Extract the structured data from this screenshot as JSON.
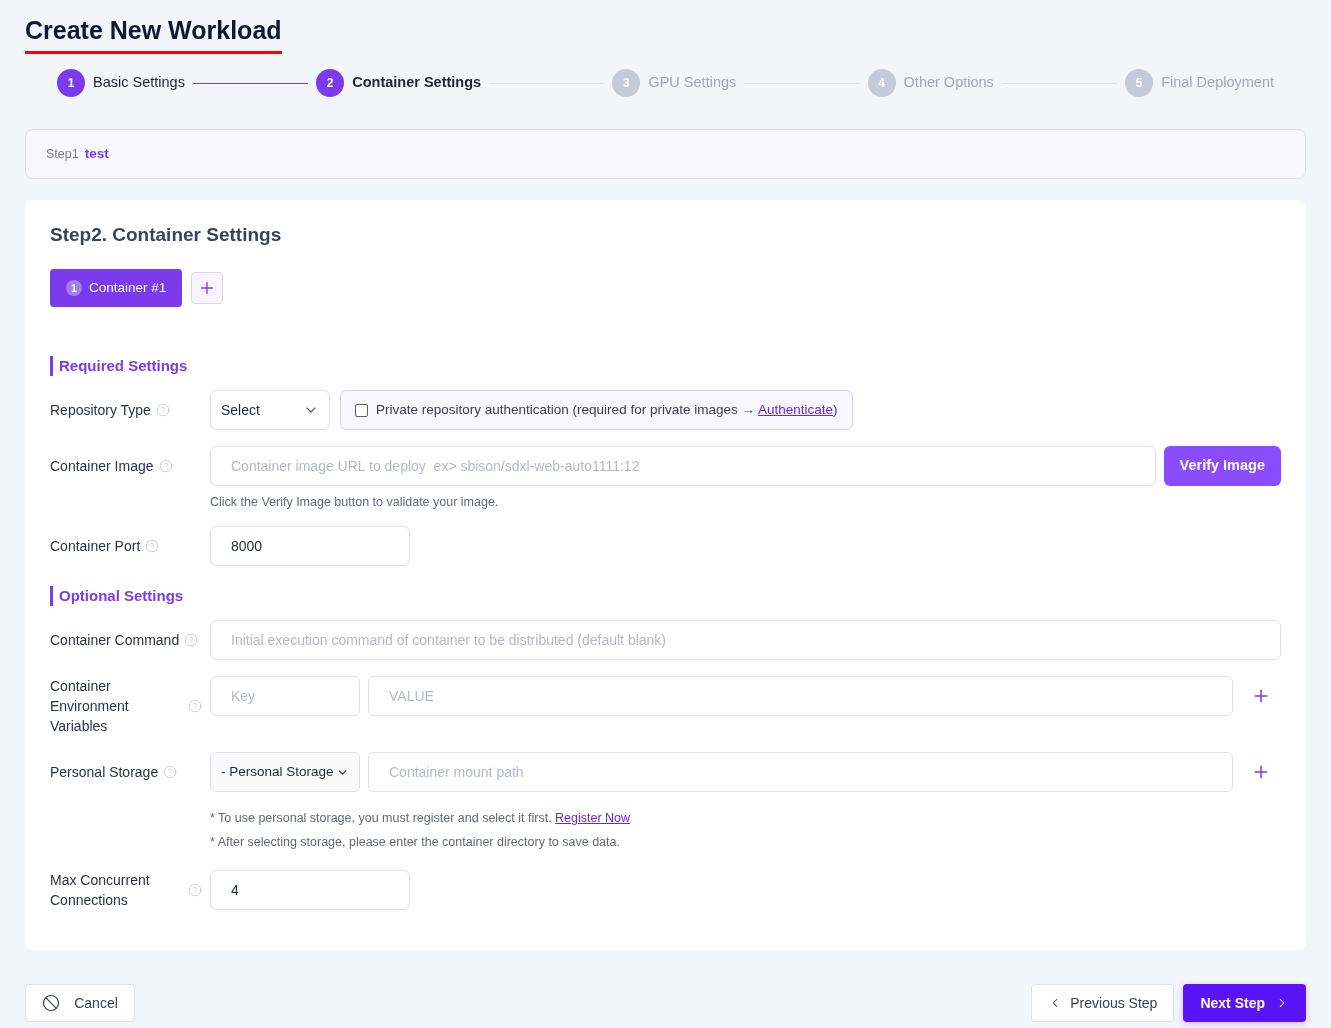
{
  "page": {
    "title": "Create New Workload"
  },
  "stepper": [
    {
      "number": "1",
      "label": "Basic Settings",
      "active": true,
      "selected": false
    },
    {
      "number": "2",
      "label": "Container Settings",
      "active": true,
      "selected": true
    },
    {
      "number": "3",
      "label": "GPU Settings",
      "active": false,
      "selected": false
    },
    {
      "number": "4",
      "label": "Other Options",
      "active": false,
      "selected": false
    },
    {
      "number": "5",
      "label": "Final Deployment",
      "active": false,
      "selected": false
    }
  ],
  "summary": {
    "label": "Step1",
    "value": "test"
  },
  "section": {
    "title": "Step2. Container Settings"
  },
  "container_tabs": [
    {
      "number": "1",
      "label": "Container #1",
      "selected": true
    }
  ],
  "groups": [
    {
      "title": "Required Settings",
      "fields": [
        {
          "kind": "select",
          "label": "Repository Type",
          "select": "Select",
          "auth": {
            "checked": false,
            "text": "Private repository authentication (required for private images → ",
            "link": "Authenticate",
            "suffix": ")"
          }
        },
        {
          "kind": "verify",
          "label": "Container Image",
          "placeholder": "Container image URL to deploy  ex> sbison/sdxl-web-auto1111:12",
          "button": "Verify Image",
          "hint": "Click the Verify Image button to validate your image."
        },
        {
          "kind": "short",
          "label": "Container Port",
          "value": "8000"
        }
      ]
    },
    {
      "title": "Optional Settings",
      "fields": [
        {
          "kind": "wide",
          "label": "Container Command",
          "placeholder": "Initial execution command of container to be distributed (default blank)"
        },
        {
          "kind": "pair",
          "label": "Container Environment Variables",
          "key_placeholder": "Key",
          "value_placeholder": "VALUE"
        },
        {
          "kind": "storage",
          "label": "Personal Storage",
          "select": "- Personal Storage",
          "placeholder": "Container mount path",
          "notes": [
            {
              "text": "* To use personal storage, you must register and select it first. ",
              "link": "Register Now"
            },
            {
              "text": "* After selecting storage, please enter the container directory to save data."
            }
          ]
        },
        {
          "kind": "short",
          "label": "Max Concurrent Connections",
          "value": "4"
        }
      ]
    }
  ],
  "footer": {
    "cancel": "Cancel",
    "previous": "Previous Step",
    "next": "Next Step"
  }
}
